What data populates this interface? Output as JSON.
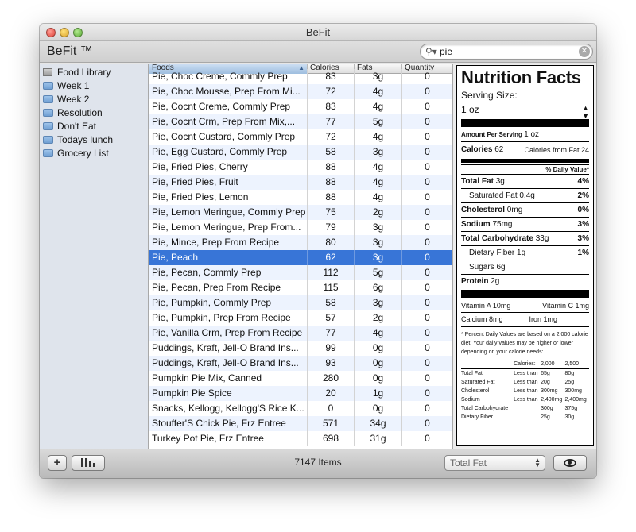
{
  "window": {
    "title": "BeFit"
  },
  "app": {
    "name": "BeFit ™"
  },
  "search": {
    "value": "pie",
    "icon": "magnifier-icon"
  },
  "sidebar": {
    "items": [
      {
        "label": "Food Library",
        "icon": "library-icon"
      },
      {
        "label": "Week 1",
        "icon": "folder-icon"
      },
      {
        "label": "Week 2",
        "icon": "folder-icon"
      },
      {
        "label": "Resolution",
        "icon": "folder-icon"
      },
      {
        "label": "Don't Eat",
        "icon": "folder-icon"
      },
      {
        "label": "Todays lunch",
        "icon": "folder-icon"
      },
      {
        "label": "Grocery List",
        "icon": "folder-icon"
      }
    ]
  },
  "table": {
    "headers": {
      "foods": "Foods",
      "calories": "Calories",
      "fats": "Fats",
      "quantity": "Quantity"
    },
    "selected_index": 12,
    "rows": [
      {
        "food": "Pie, Choc Creme, Commly Prep",
        "calories": "83",
        "fats": "3g",
        "quantity": "0"
      },
      {
        "food": "Pie, Choc Mousse, Prep From Mi...",
        "calories": "72",
        "fats": "4g",
        "quantity": "0"
      },
      {
        "food": "Pie, Cocnt Creme, Commly Prep",
        "calories": "83",
        "fats": "4g",
        "quantity": "0"
      },
      {
        "food": "Pie, Cocnt Crm, Prep From Mix,...",
        "calories": "77",
        "fats": "5g",
        "quantity": "0"
      },
      {
        "food": "Pie, Cocnt Custard, Commly Prep",
        "calories": "72",
        "fats": "4g",
        "quantity": "0"
      },
      {
        "food": "Pie, Egg Custard, Commly Prep",
        "calories": "58",
        "fats": "3g",
        "quantity": "0"
      },
      {
        "food": "Pie, Fried Pies, Cherry",
        "calories": "88",
        "fats": "4g",
        "quantity": "0"
      },
      {
        "food": "Pie, Fried Pies, Fruit",
        "calories": "88",
        "fats": "4g",
        "quantity": "0"
      },
      {
        "food": "Pie, Fried Pies, Lemon",
        "calories": "88",
        "fats": "4g",
        "quantity": "0"
      },
      {
        "food": "Pie, Lemon Meringue, Commly Prep",
        "calories": "75",
        "fats": "2g",
        "quantity": "0"
      },
      {
        "food": "Pie, Lemon Meringue, Prep From...",
        "calories": "79",
        "fats": "3g",
        "quantity": "0"
      },
      {
        "food": "Pie, Mince, Prep From Recipe",
        "calories": "80",
        "fats": "3g",
        "quantity": "0"
      },
      {
        "food": "Pie, Peach",
        "calories": "62",
        "fats": "3g",
        "quantity": "0"
      },
      {
        "food": "Pie, Pecan, Commly Prep",
        "calories": "112",
        "fats": "5g",
        "quantity": "0"
      },
      {
        "food": "Pie, Pecan, Prep From Recipe",
        "calories": "115",
        "fats": "6g",
        "quantity": "0"
      },
      {
        "food": "Pie, Pumpkin, Commly Prep",
        "calories": "58",
        "fats": "3g",
        "quantity": "0"
      },
      {
        "food": "Pie, Pumpkin, Prep From Recipe",
        "calories": "57",
        "fats": "2g",
        "quantity": "0"
      },
      {
        "food": "Pie, Vanilla Crm, Prep From Recipe",
        "calories": "77",
        "fats": "4g",
        "quantity": "0"
      },
      {
        "food": "Puddings, Kraft, Jell-O Brand Ins...",
        "calories": "99",
        "fats": "0g",
        "quantity": "0"
      },
      {
        "food": "Puddings, Kraft, Jell-O Brand Ins...",
        "calories": "93",
        "fats": "0g",
        "quantity": "0"
      },
      {
        "food": "Pumpkin Pie Mix, Canned",
        "calories": "280",
        "fats": "0g",
        "quantity": "0"
      },
      {
        "food": "Pumpkin Pie Spice",
        "calories": "20",
        "fats": "1g",
        "quantity": "0"
      },
      {
        "food": "Snacks, Kellogg, Kellogg'S Rice K...",
        "calories": "0",
        "fats": "0g",
        "quantity": "0"
      },
      {
        "food": "Stouffer'S Chick Pie, Frz Entree",
        "calories": "571",
        "fats": "34g",
        "quantity": "0"
      },
      {
        "food": "Turkey Pot Pie, Frz Entree",
        "calories": "698",
        "fats": "31g",
        "quantity": "0"
      }
    ]
  },
  "nutrition": {
    "title": "Nutrition Facts",
    "serving_size_label": "Serving Size:",
    "serving_size_value": "1 oz",
    "amount_per_serving_label": "Amount Per Serving",
    "amount_per_serving_value": "1 oz",
    "calories_label": "Calories",
    "calories_value": "62",
    "calories_from_fat": "Calories from Fat 24",
    "daily_value_header": "% Daily Value*",
    "total_fat_label": "Total Fat",
    "total_fat_value": "3g",
    "total_fat_pct": "4%",
    "saturated_fat_label": "Saturated Fat",
    "saturated_fat_value": "0.4g",
    "saturated_fat_pct": "2%",
    "cholesterol_label": "Cholesterol",
    "cholesterol_value": "0mg",
    "cholesterol_pct": "0%",
    "sodium_label": "Sodium",
    "sodium_value": "75mg",
    "sodium_pct": "3%",
    "total_carb_label": "Total Carbohydrate",
    "total_carb_value": "33g",
    "total_carb_pct": "3%",
    "dietary_fiber_label": "Dietary Fiber",
    "dietary_fiber_value": "1g",
    "dietary_fiber_pct": "1%",
    "sugars_label": "Sugars",
    "sugars_value": "6g",
    "protein_label": "Protein",
    "protein_value": "2g",
    "vitamin_a": "Vitamin A 10mg",
    "vitamin_c": "Vitamin C 1mg",
    "calcium": "Calcium 8mg",
    "iron": "Iron 1mg",
    "footnote": "* Percent Daily Values are based on a 2,000 calorie diet. Your daily values may be higher or lower depending on your calorie needs:",
    "dv_table": {
      "header": [
        "",
        "Calories:",
        "2,000",
        "2,500"
      ],
      "rows": [
        [
          "Total Fat",
          "Less than",
          "65g",
          "80g"
        ],
        [
          "Saturated Fat",
          "Less than",
          "20g",
          "25g"
        ],
        [
          "Cholesterol",
          "Less than",
          "300mg",
          "300mg"
        ],
        [
          "Sodium",
          "Less than",
          "2,400mg",
          "2,400mg"
        ],
        [
          "Total Carbohydrate",
          "",
          "300g",
          "375g"
        ],
        [
          "Dietary Fiber",
          "",
          "25g",
          "30g"
        ]
      ]
    }
  },
  "bottombar": {
    "add_label": "+",
    "item_count": "7147 Items",
    "sort_select_value": "Total Fat"
  }
}
